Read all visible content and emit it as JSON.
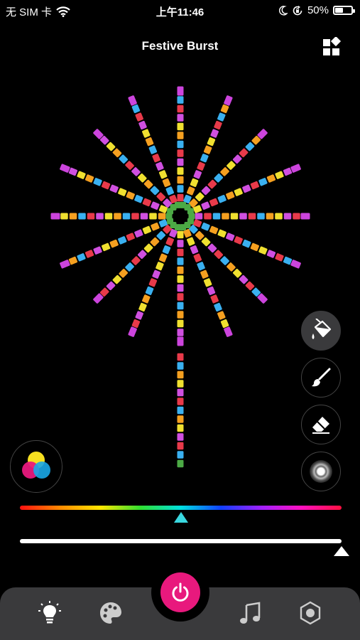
{
  "status_bar": {
    "carrier": "无 SIM 卡",
    "time": "上午11:46",
    "battery": "50%",
    "battery_level": 0.5,
    "icons": [
      "wifi-icon",
      "moon-icon",
      "rotation-lock-icon",
      "battery-icon"
    ]
  },
  "header": {
    "title": "Festive Burst",
    "right_icon": "layout-grid-icon"
  },
  "burst": {
    "ray_colors": [
      "#e83a4a",
      "#3ab0f0",
      "#f5a020",
      "#f0e030",
      "#d050e0"
    ],
    "tip_color": "#cc44dd",
    "hub_color": "#4caa45",
    "stem_bottom_color": "#4caa45",
    "rays": 16
  },
  "tools": [
    {
      "name": "paint-bucket",
      "icon": "paint-bucket-icon",
      "active": true
    },
    {
      "name": "brush",
      "icon": "brush-icon",
      "active": false
    },
    {
      "name": "eraser",
      "icon": "eraser-icon",
      "active": false
    },
    {
      "name": "radial-gradient",
      "icon": "radial-gradient-icon",
      "active": false
    }
  ],
  "color_mix_icon": "rgb-circles-icon",
  "sliders": {
    "hue": {
      "value": 0.5,
      "thumb_color": "#3ad8e0"
    },
    "white": {
      "value": 1.0
    }
  },
  "tab_bar": {
    "tabs": [
      {
        "name": "light",
        "icon": "light-bulb-icon"
      },
      {
        "name": "palette",
        "icon": "palette-icon"
      },
      {
        "name": "power",
        "icon": "power-icon"
      },
      {
        "name": "music",
        "icon": "music-note-icon"
      },
      {
        "name": "settings",
        "icon": "hexagon-icon"
      }
    ],
    "power_color": "#e8197d"
  }
}
